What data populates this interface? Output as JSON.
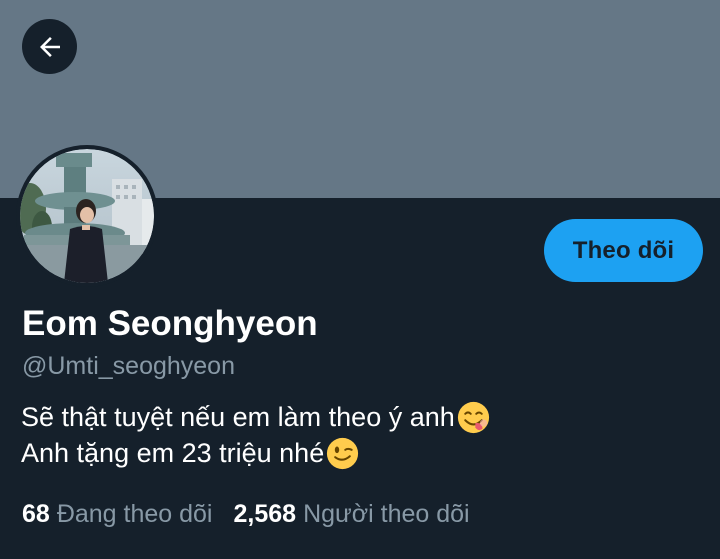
{
  "profile": {
    "display_name": "Eom Seonghyeon",
    "handle": "@Umti_seoghyeon",
    "bio_line1": "Sẽ thật tuyệt nếu em làm theo ý anh",
    "bio_line1_emoji": "face-savoring-food-emoji",
    "bio_line2": "Anh tặng em 23 triệu nhé",
    "bio_line2_emoji": "winking-face-emoji",
    "follow_label": "Theo dõi"
  },
  "stats": {
    "following_count": "68",
    "following_label": "Đang theo dõi",
    "followers_count": "2,568",
    "followers_label": "Người theo dõi"
  },
  "icons": {
    "back": "arrow-left-icon"
  },
  "colors": {
    "background": "#15202b",
    "banner": "#657786",
    "accent": "#1da1f2",
    "secondary_text": "#8899a6"
  }
}
